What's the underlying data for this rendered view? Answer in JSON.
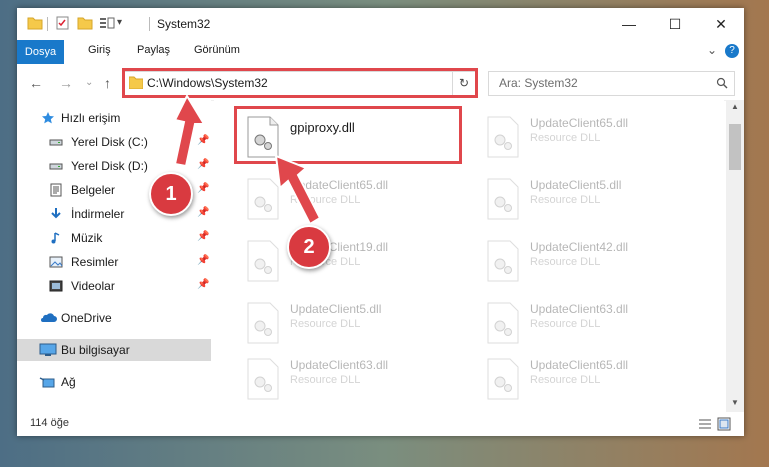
{
  "titlebar": {
    "title": "System32",
    "minimize": "—",
    "maximize": "☐",
    "close": "✕"
  },
  "ribbon": {
    "file_tab": "Dosya",
    "tabs": [
      "Giriş",
      "Paylaş",
      "Görünüm"
    ],
    "collapse": "⌄",
    "help": "?"
  },
  "navbar": {
    "back": "←",
    "forward": "→",
    "recent": "⌄",
    "up": "↑",
    "address": "C:\\Windows\\System32",
    "refresh": "↻",
    "search_placeholder": "Ara: System32"
  },
  "sidebar": {
    "items": [
      {
        "label": "Hızlı erişim",
        "icon": "star-icon",
        "pinned": false
      },
      {
        "label": "Yerel Disk (C:)",
        "icon": "drive-icon",
        "pinned": true
      },
      {
        "label": "Yerel Disk (D:)",
        "icon": "drive-icon",
        "pinned": true
      },
      {
        "label": "Belgeler",
        "icon": "documents-icon",
        "pinned": true
      },
      {
        "label": "İndirmeler",
        "icon": "download-icon",
        "pinned": true
      },
      {
        "label": "Müzik",
        "icon": "music-icon",
        "pinned": true
      },
      {
        "label": "Resimler",
        "icon": "pictures-icon",
        "pinned": true
      },
      {
        "label": "Videolar",
        "icon": "videos-icon",
        "pinned": true
      },
      {
        "label": "OneDrive",
        "icon": "cloud-icon",
        "pinned": false
      },
      {
        "label": "Bu bilgisayar",
        "icon": "computer-icon",
        "pinned": false,
        "selected": true
      },
      {
        "label": "Ağ",
        "icon": "network-icon",
        "pinned": false
      }
    ],
    "pin_glyph": "📌"
  },
  "files": [
    {
      "name": "gpiproxy.dll",
      "type": ""
    },
    {
      "name": "UpdateClient65.dll",
      "type": "Resource DLL"
    },
    {
      "name": "UpdateClient65.dll",
      "type": "Resource DLL"
    },
    {
      "name": "UpdateClient5.dll",
      "type": "Resource DLL"
    },
    {
      "name": "UpdateClient19.dll",
      "type": "Resource DLL"
    },
    {
      "name": "UpdateClient42.dll",
      "type": "Resource DLL"
    },
    {
      "name": "UpdateClient5.dll",
      "type": "Resource DLL"
    },
    {
      "name": "UpdateClient63.dll",
      "type": "Resource DLL"
    },
    {
      "name": "UpdateClient63.dll",
      "type": "Resource DLL"
    },
    {
      "name": "UpdateClient65.dll",
      "type": "Resource DLL"
    }
  ],
  "status": {
    "count": "114 öğe"
  },
  "annotations": {
    "step1": "1",
    "step2": "2",
    "accent": "#e0474c"
  }
}
